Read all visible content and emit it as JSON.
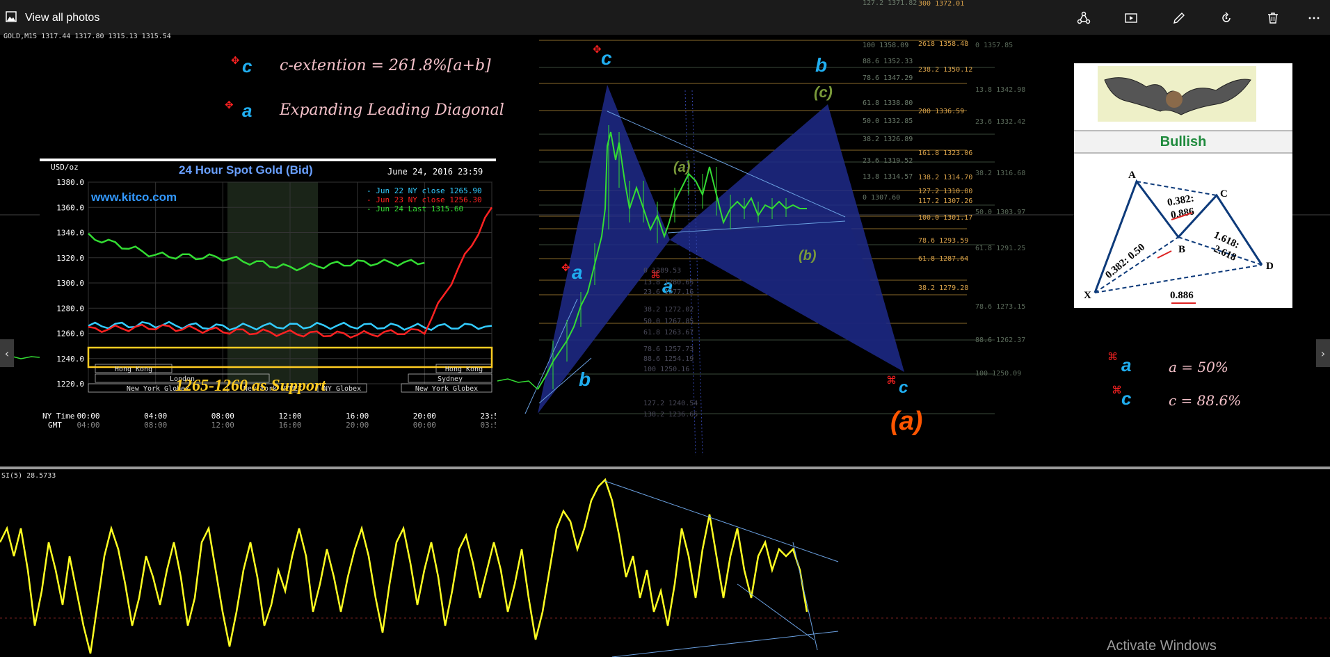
{
  "window": {
    "title": "View all photos",
    "toolbar_icons": [
      "share-icon",
      "slideshow-icon",
      "edit-icon",
      "rotate-icon",
      "delete-icon",
      "more-icon"
    ]
  },
  "mt4": {
    "header": "GOLD,M15  1317.44 1317.80 1315.13 1315.54",
    "indicator_header": "SI(5) 28.5733"
  },
  "annotations": {
    "line1_label": "c",
    "line1_text": "c-extention = 261.8%[a+b]",
    "line2_label": "a",
    "line2_text": "Expanding Leading Diagonal",
    "right_a_label": "a",
    "right_a_text": "a = 50%",
    "right_c_label": "c",
    "right_c_text": "c = 88.6%"
  },
  "waves": {
    "c_top": "c",
    "a_mid": "a",
    "b_low": "b",
    "a_center": "a",
    "b_top": "b",
    "c_right": "c",
    "a_paren": "(a)",
    "c_paren": "(c)",
    "b_paren": "(b)",
    "a_paren_small": "(a)"
  },
  "fib_levels": {
    "left": [
      {
        "label": "127.2 1371.82"
      },
      {
        "label": "100 1358.09"
      },
      {
        "label": "88.6 1352.33"
      },
      {
        "label": "78.6 1347.29"
      },
      {
        "label": "61.8 1338.80"
      },
      {
        "label": "50.0 1332.85"
      },
      {
        "label": "38.2 1326.89"
      },
      {
        "label": "23.6 1319.52"
      },
      {
        "label": "13.8 1314.57"
      },
      {
        "label": "0 1307.60"
      }
    ],
    "right": [
      {
        "label": "300 1372.01"
      },
      {
        "label": "2618 1358.48"
      },
      {
        "label": "238.2 1350.12"
      },
      {
        "label": "200 1336.59"
      },
      {
        "label": "161.8 1323.06"
      },
      {
        "label": "138.2 1314.70"
      },
      {
        "label": "127.2 1310.80"
      },
      {
        "label": "117.2 1307.26"
      },
      {
        "label": "100.0 1301.17"
      },
      {
        "label": "78.6 1293.59"
      },
      {
        "label": "61.8 1287.64"
      },
      {
        "label": "38.2 1279.28"
      }
    ],
    "far_right": [
      {
        "label": "0 1357.85"
      },
      {
        "label": "13.8 1342.98"
      },
      {
        "label": "23.6 1332.42"
      },
      {
        "label": "38.2 1316.68"
      },
      {
        "label": "50.0 1303.97"
      },
      {
        "label": "61.8 1291.25"
      },
      {
        "label": "78.6 1273.15"
      },
      {
        "label": "88.6 1262.37"
      },
      {
        "label": "100 1250.09"
      }
    ],
    "low": [
      {
        "label": "0 1289.53"
      },
      {
        "label": "13.8 1280.65"
      },
      {
        "label": "23.6 1277.16"
      },
      {
        "label": "38.2 1272.02"
      },
      {
        "label": "50.0 1267.85"
      },
      {
        "label": "61.8 1263.67"
      },
      {
        "label": "78.6 1257.73"
      },
      {
        "label": "88.6 1254.19"
      },
      {
        "label": "100 1250.16"
      },
      {
        "label": "127.2 1240.54"
      },
      {
        "label": "138.2 1236.65"
      }
    ]
  },
  "kitco": {
    "units": "USD/oz",
    "title": "24 Hour Spot Gold (Bid)",
    "date": "June 24, 2016 23:59",
    "site": "www.kitco.com",
    "support_label": "1265-1260 as Support",
    "legend": [
      {
        "name": "Jun 22 NY close 1265.90",
        "color": "#33ccff"
      },
      {
        "name": "Jun 23 NY close 1256.30",
        "color": "#ff2222"
      },
      {
        "name": "Jun 24 Last 1315.60",
        "color": "#33dd33"
      }
    ],
    "y_ticks": [
      "1380.0",
      "1360.0",
      "1340.0",
      "1320.0",
      "1300.0",
      "1280.0",
      "1260.0",
      "1240.0",
      "1220.0"
    ],
    "ny_label": "NY Time",
    "gmt_label": "GMT",
    "ny_ticks": [
      "00:00",
      "04:00",
      "08:00",
      "12:00",
      "16:00",
      "20:00",
      "23:59"
    ],
    "gmt_ticks": [
      "04:00",
      "08:00",
      "12:00",
      "16:00",
      "20:00",
      "00:00",
      "03:59"
    ],
    "sessions_top": [
      "Hong Kong",
      "Hong Kong"
    ],
    "sessions_mid": [
      "London",
      "Sydney"
    ],
    "sessions_bot": [
      "New York Globex",
      "New York NYMEX",
      "NY Globex",
      "New York Globex"
    ]
  },
  "bat": {
    "title": "Bullish",
    "points": [
      "A",
      "B",
      "C",
      "D",
      "X"
    ],
    "ratios": [
      "0.382:",
      "0.886",
      "0.382: 0.50",
      "1.618:",
      "2.618",
      "0.886"
    ]
  },
  "chart_data": {
    "type": "line",
    "title": "24 Hour Spot Gold (Bid)",
    "ylabel": "USD/oz",
    "ylim": [
      1220,
      1380
    ],
    "x": [
      "00:00",
      "04:00",
      "08:00",
      "12:00",
      "16:00",
      "20:00",
      "23:59"
    ],
    "series": [
      {
        "name": "Jun 22 NY close 1265.90",
        "values": [
          1266,
          1267,
          1265,
          1266,
          1266,
          1265,
          1266
        ]
      },
      {
        "name": "Jun 23 NY close 1256.30",
        "values": [
          1263,
          1265,
          1262,
          1260,
          1259,
          1262,
          1360
        ]
      },
      {
        "name": "Jun 24 Last 1315.60",
        "values": [
          1337,
          1322,
          1320,
          1312,
          1316,
          1316
        ]
      }
    ]
  }
}
